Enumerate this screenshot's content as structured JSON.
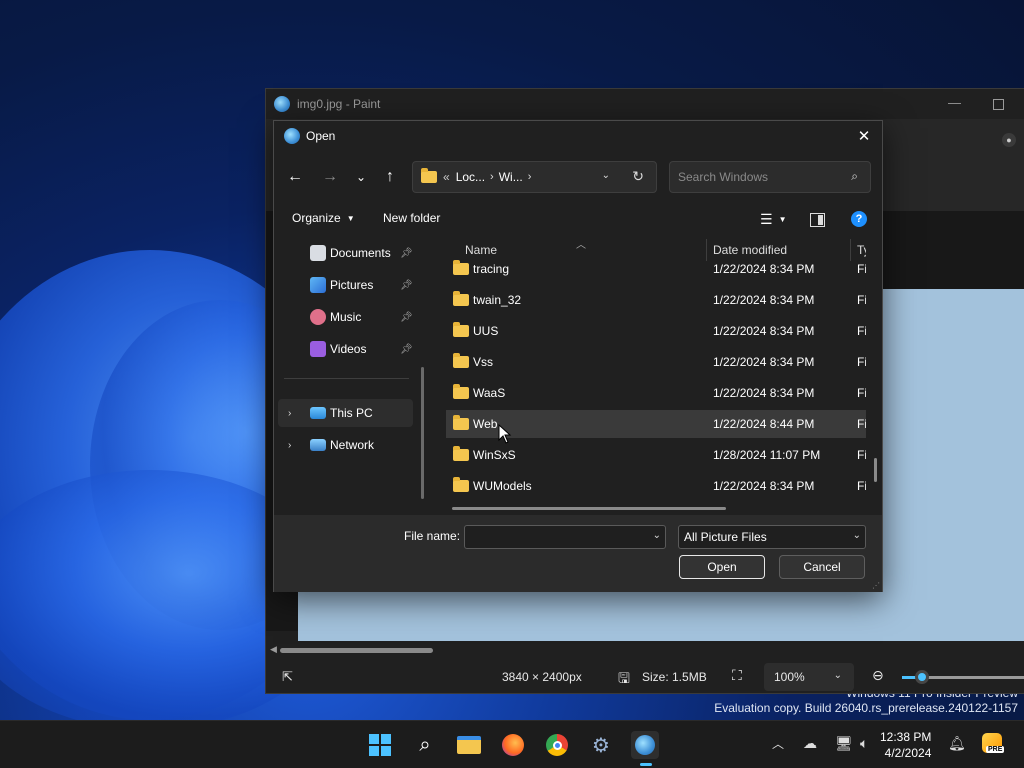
{
  "paint": {
    "title": "img0.jpg - Paint",
    "status": {
      "dimensions": "3840 × 2400px",
      "size": "Size: 1.5MB",
      "zoom": "100%",
      "zoom_slider_fraction": 0.14
    }
  },
  "dialog": {
    "title": "Open",
    "breadcrumb": {
      "overflow": "«",
      "parts": [
        "Loc...",
        "Wi..."
      ]
    },
    "search_placeholder": "Search Windows",
    "commands": {
      "organize": "Organize",
      "new_folder": "New folder"
    },
    "nav_items": [
      {
        "label": "Documents",
        "icon": "documents-icon",
        "pinned": true
      },
      {
        "label": "Pictures",
        "icon": "pictures-icon",
        "pinned": true
      },
      {
        "label": "Music",
        "icon": "music-icon",
        "pinned": true
      },
      {
        "label": "Videos",
        "icon": "videos-icon",
        "pinned": true
      },
      {
        "label": "This PC",
        "icon": "this-pc-icon",
        "selected": true
      },
      {
        "label": "Network",
        "icon": "network-icon"
      }
    ],
    "columns": {
      "name": "Name",
      "date": "Date modified",
      "type": "Ty"
    },
    "files": [
      {
        "name": "tracing",
        "date": "1/22/2024 8:34 PM",
        "type": "Fi"
      },
      {
        "name": "twain_32",
        "date": "1/22/2024 8:34 PM",
        "type": "Fi"
      },
      {
        "name": "UUS",
        "date": "1/22/2024 8:34 PM",
        "type": "Fi"
      },
      {
        "name": "Vss",
        "date": "1/22/2024 8:34 PM",
        "type": "Fi"
      },
      {
        "name": "WaaS",
        "date": "1/22/2024 8:34 PM",
        "type": "Fi"
      },
      {
        "name": "Web",
        "date": "1/22/2024 8:44 PM",
        "type": "Fi",
        "hover": true
      },
      {
        "name": "WinSxS",
        "date": "1/28/2024 11:07 PM",
        "type": "Fi"
      },
      {
        "name": "WUModels",
        "date": "1/22/2024 8:34 PM",
        "type": "Fi"
      }
    ],
    "file_name_label": "File name:",
    "file_name_value": "",
    "filter": "All Picture Files",
    "open_label": "Open",
    "cancel_label": "Cancel"
  },
  "watermark": {
    "line1": "Windows 11 Pro Insider Preview",
    "line2": "Evaluation copy. Build 26040.rs_prerelease.240122-1157"
  },
  "taskbar": {
    "time": "12:38 PM",
    "date": "4/2/2024",
    "badge": "PRE"
  },
  "colors": {
    "accent": "#4cc2ff",
    "folder": "#f4c64f",
    "dialog_bg": "#202020"
  }
}
